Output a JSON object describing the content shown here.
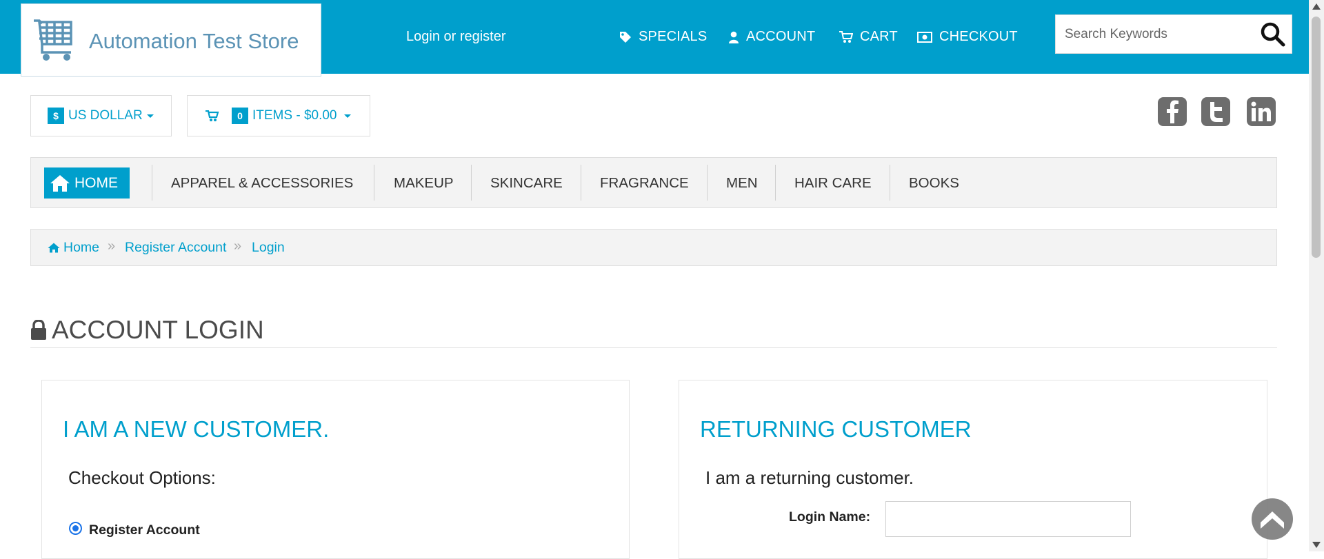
{
  "header": {
    "store_name": "Automation Test Store",
    "login_link": "Login or register",
    "nav": [
      {
        "label": "SPECIALS",
        "icon": "tag-icon"
      },
      {
        "label": "ACCOUNT",
        "icon": "user-icon"
      },
      {
        "label": "CART",
        "icon": "cart-icon"
      },
      {
        "label": "CHECKOUT",
        "icon": "money-icon"
      }
    ],
    "search_placeholder": "Search Keywords"
  },
  "currency": {
    "symbol": "$",
    "label": "US DOLLAR"
  },
  "cart_summary": {
    "count": "0",
    "label": "ITEMS - $0.00"
  },
  "social": [
    "facebook-icon",
    "twitter-icon",
    "linkedin-icon"
  ],
  "categories": {
    "home": "HOME",
    "items": [
      "APPAREL & ACCESSORIES",
      "MAKEUP",
      "SKINCARE",
      "FRAGRANCE",
      "MEN",
      "HAIR CARE",
      "BOOKS"
    ]
  },
  "breadcrumb": [
    "Home",
    "Register Account",
    "Login"
  ],
  "page_title": "ACCOUNT LOGIN",
  "new_customer": {
    "title": "I AM A NEW CUSTOMER.",
    "subtitle": "Checkout Options:",
    "option_label": "Register Account"
  },
  "returning_customer": {
    "title": "RETURNING CUSTOMER",
    "subtitle": "I am a returning customer.",
    "login_name_label": "Login Name:",
    "login_name_value": ""
  },
  "colors": {
    "brand": "#009fcc",
    "social": "#6d6d6d",
    "heading": "#4b4b4b"
  }
}
